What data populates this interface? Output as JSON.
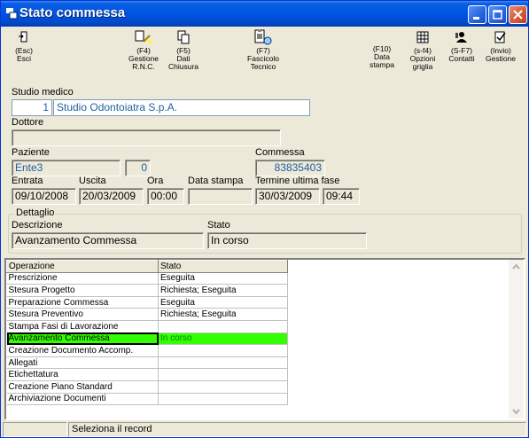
{
  "window": {
    "title": "Stato commessa"
  },
  "toolbar": {
    "esc": {
      "key": "(Esc)",
      "label": "Esci",
      "icon": "exit-door-icon"
    },
    "f4": {
      "key": "(F4)",
      "label": "Gestione R.N.C.",
      "icon": "magnifier-edit-icon"
    },
    "f5": {
      "key": "(F5)",
      "label": "Dati Chiusura",
      "icon": "copy-pages-icon"
    },
    "f7": {
      "key": "(F7)",
      "label": "Fascicolo Tecnico",
      "icon": "clipboard-search-icon"
    },
    "f10": {
      "key": "(F10)",
      "label": "Data stampa"
    },
    "sf4": {
      "key": "(s-f4)",
      "label": "Opzioni griglia",
      "icon": "grid-options-icon"
    },
    "sf7": {
      "key": "(S-F7)",
      "label": "Contatti",
      "icon": "contacts-icon"
    },
    "invio": {
      "key": "(Invio)",
      "label": "Gestione",
      "icon": "checklist-icon"
    }
  },
  "form": {
    "studio_label": "Studio medico",
    "studio_code": "1",
    "studio_name": "Studio Odontoiatra S.p.A.",
    "dottore_label": "Dottore",
    "dottore_value": "",
    "paziente_label": "Paziente",
    "paziente_value": "Ente3",
    "paziente_num": "0",
    "commessa_label": "Commessa",
    "commessa_value": "83835403",
    "entrata_label": "Entrata",
    "entrata_value": "09/10/2008",
    "uscita_label": "Uscita",
    "uscita_value": "20/03/2009",
    "ora_label": "Ora",
    "ora_value": "00:00",
    "data_stampa_label": "Data stampa",
    "data_stampa_value": "",
    "termine_label": "Termine ultima fase",
    "termine_date": "30/03/2009",
    "termine_time": "09:44"
  },
  "dettaglio": {
    "group_label": "Dettaglio",
    "descrizione_label": "Descrizione",
    "descrizione_value": "Avanzamento Commessa",
    "stato_label": "Stato",
    "stato_value": "In corso"
  },
  "grid": {
    "headers": [
      "Operazione",
      "Stato"
    ],
    "rows": [
      {
        "operazione": "Prescrizione",
        "stato": "Eseguita"
      },
      {
        "operazione": "Stesura Progetto",
        "stato": "Richiesta; Eseguita"
      },
      {
        "operazione": "Preparazione Commessa",
        "stato": "Eseguita"
      },
      {
        "operazione": "Stesura Preventivo",
        "stato": "Richiesta; Eseguita"
      },
      {
        "operazione": "Stampa Fasi di Lavorazione",
        "stato": ""
      },
      {
        "operazione": "Avanzamento Commessa",
        "stato": "In corso"
      },
      {
        "operazione": "Creazione Documento Accomp.",
        "stato": ""
      },
      {
        "operazione": "Allegati",
        "stato": ""
      },
      {
        "operazione": "Etichettatura",
        "stato": ""
      },
      {
        "operazione": "Creazione Piano Standard",
        "stato": ""
      },
      {
        "operazione": "Archiviazione Documenti",
        "stato": ""
      }
    ],
    "selected_index": 5
  },
  "statusbar": {
    "left": "",
    "message": "Seleziona il record"
  },
  "colors": {
    "titlebar": "#0054e3",
    "selected_row": "#33ff00",
    "field_text": "#1f5fa0"
  }
}
